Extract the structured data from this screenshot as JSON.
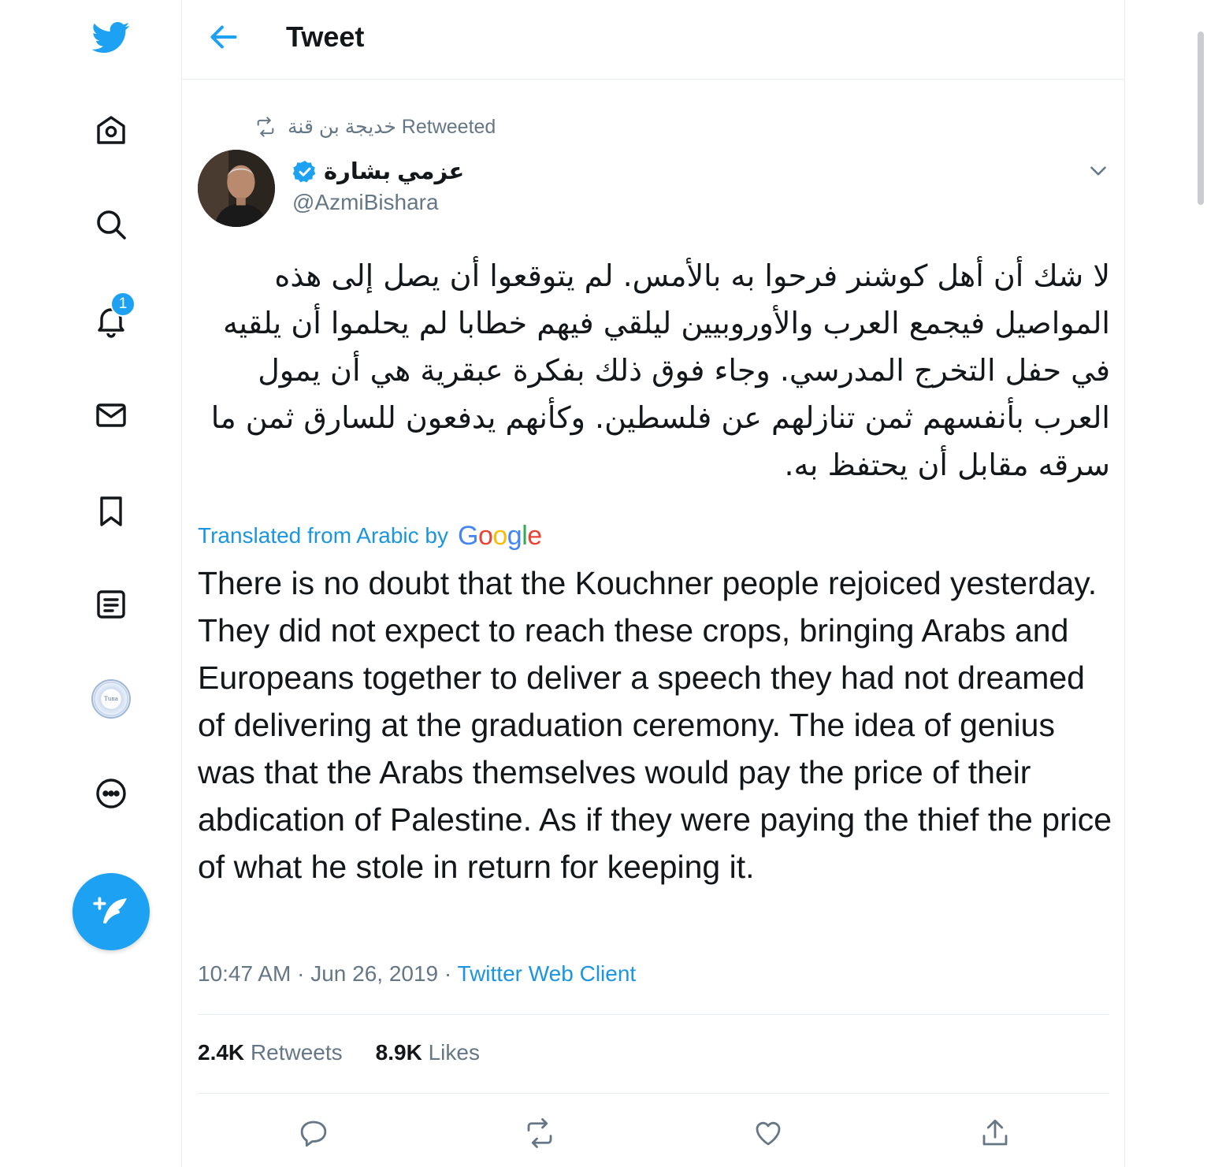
{
  "colors": {
    "brand": "#1da1f2",
    "link": "#1b95e0",
    "muted": "#657786",
    "text": "#14171a",
    "border": "#e6ecf0"
  },
  "sidebar": {
    "logo_icon": "twitter-bird-icon",
    "items": [
      {
        "name": "home",
        "icon": "home-icon"
      },
      {
        "name": "explore",
        "icon": "search-icon"
      },
      {
        "name": "notifications",
        "icon": "bell-icon",
        "badge": "1"
      },
      {
        "name": "messages",
        "icon": "mail-icon"
      },
      {
        "name": "bookmarks",
        "icon": "bookmark-icon"
      },
      {
        "name": "lists",
        "icon": "list-icon"
      },
      {
        "name": "profile",
        "icon": "profile-avatar"
      },
      {
        "name": "more",
        "icon": "more-circle-icon"
      }
    ],
    "compose_icon": "compose-feather-icon"
  },
  "header": {
    "back_icon": "back-arrow-icon",
    "title": "Tweet"
  },
  "tweet": {
    "retweet_context": {
      "icon": "retweet-icon",
      "text": "خديجة بن قنة Retweeted"
    },
    "author": {
      "name": "عزمي بشارة",
      "handle": "@AzmiBishara",
      "verified": true
    },
    "text_arabic": "لا شك أن أهل كوشنر فرحوا به بالأمس. لم يتوقعوا أن يصل إلى هذه المواصيل فيجمع العرب والأوروبيين ليلقي فيهم خطابا لم يحلموا أن يلقيه في حفل التخرج المدرسي. وجاء فوق ذلك بفكرة عبقرية هي أن يمول العرب بأنفسهم ثمن تنازلهم عن فلسطين. وكأنهم يدفعون للسارق ثمن ما سرقه مقابل أن يحتفظ به.",
    "translation": {
      "label": "Translated from Arabic by",
      "provider": "Google",
      "text": "There is no doubt that the Kouchner people rejoiced yesterday. They did not expect to reach these crops, bringing Arabs and Europeans together to deliver a speech they had not dreamed of delivering at the graduation ceremony. The idea of genius was that the Arabs themselves would pay the price of their abdication of Palestine. As if they were paying the thief the price of what he stole in return for keeping it."
    },
    "time": "10:47 AM",
    "separator": "·",
    "date": "Jun 26, 2019",
    "source": "Twitter Web Client",
    "stats": {
      "retweets_count": "2.4K",
      "retweets_label": "Retweets",
      "likes_count": "8.9K",
      "likes_label": "Likes"
    },
    "actions": [
      {
        "name": "reply",
        "icon": "reply-icon"
      },
      {
        "name": "retweet",
        "icon": "retweet-icon"
      },
      {
        "name": "like",
        "icon": "heart-icon"
      },
      {
        "name": "share",
        "icon": "share-icon"
      }
    ]
  }
}
